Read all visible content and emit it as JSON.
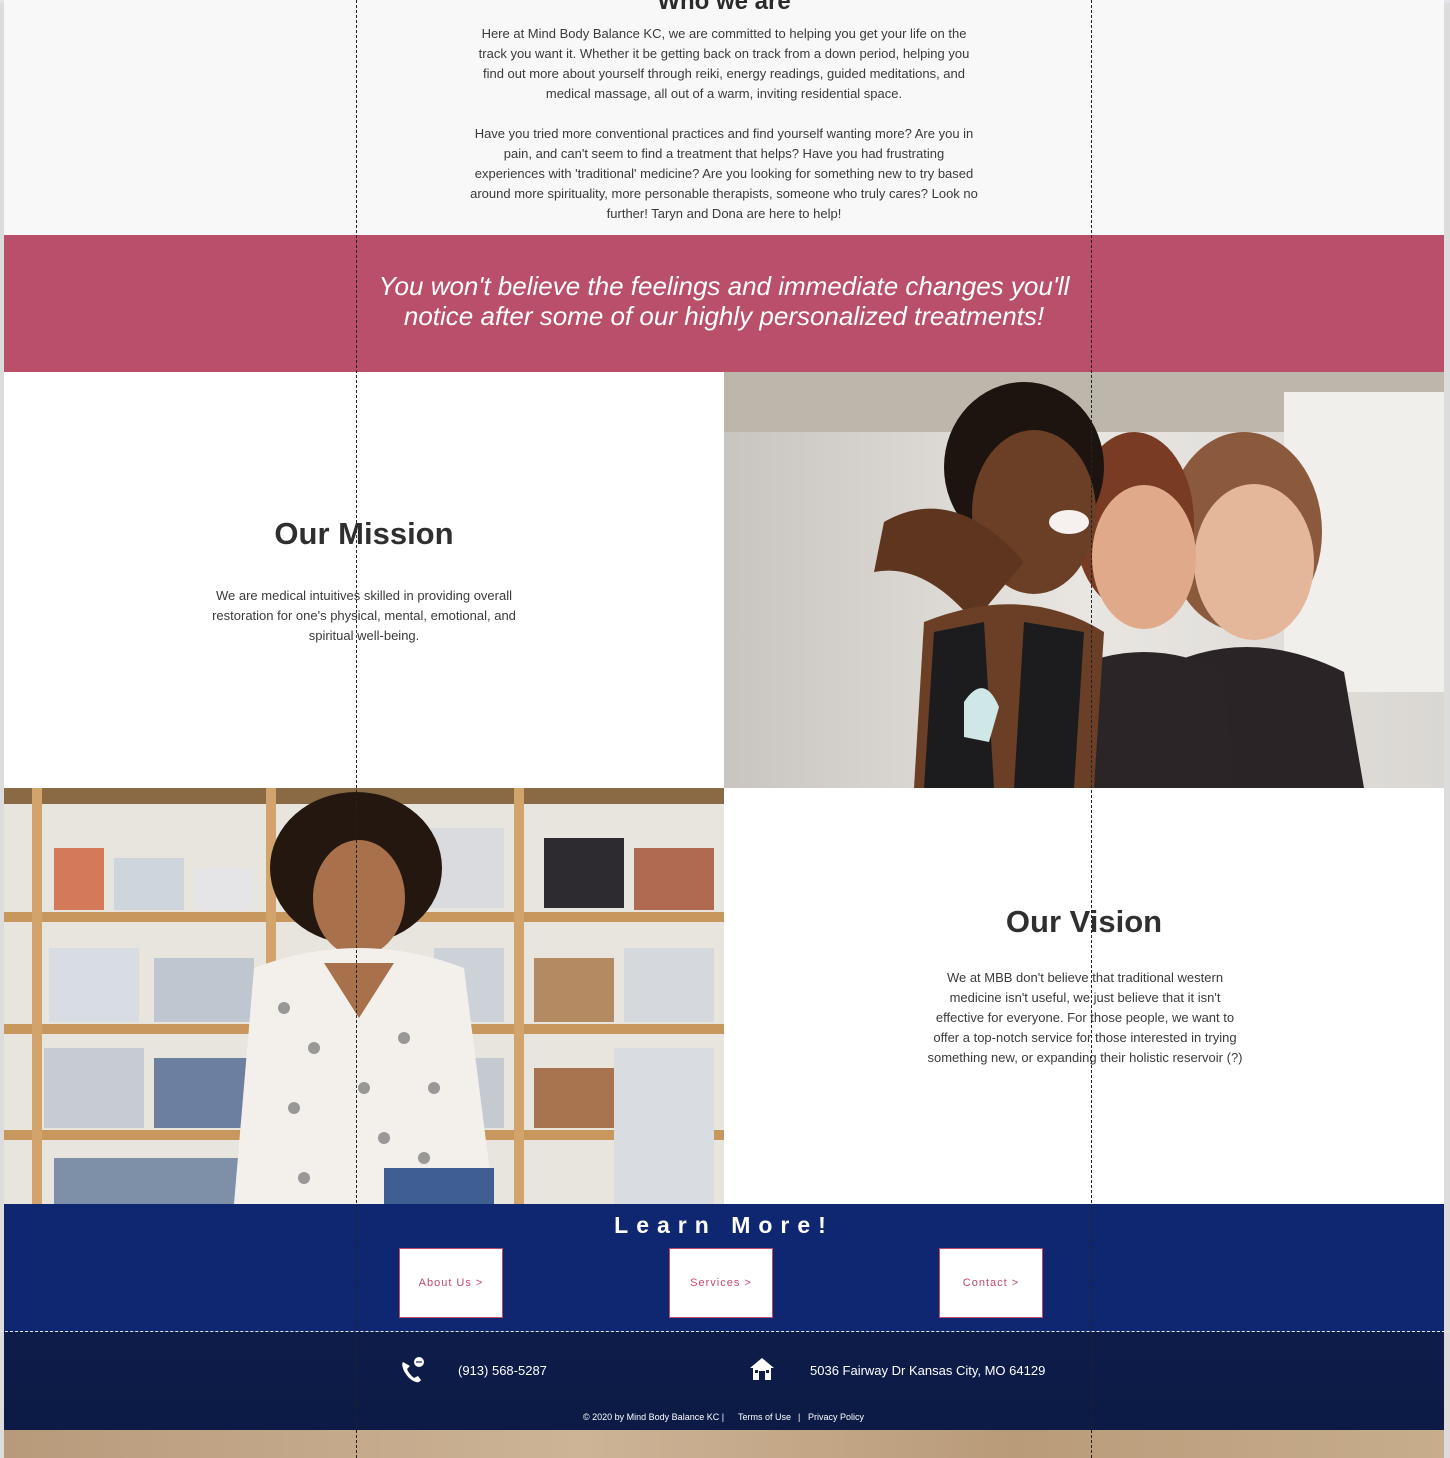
{
  "who_we_are": {
    "title": "Who we are",
    "paragraph1": "Here at Mind Body Balance KC, we are committed to helping you get your life on the track you want it. Whether it be getting back on track from a down period, helping you find out more about yourself through reiki, energy readings, guided meditations, and medical massage, all out of a warm, inviting residential space.",
    "paragraph2": "Have you tried more conventional practices and find yourself wanting more? Are you in pain, and can't seem to find a treatment that helps? Have you had frustrating experiences with 'traditional' medicine? Are you looking for something new to try based around more spirituality, more personable therapists, someone who truly cares? Look no further! Taryn and Dona are here to help!"
  },
  "banner": {
    "text": "You won't believe the feelings and immediate changes you'll notice after some of our highly personalized treatments!"
  },
  "mission": {
    "title": "Our Mission",
    "text": "We are medical intuitives skilled in providing overall restoration for one's physical, mental, emotional, and spiritual well-being."
  },
  "vision": {
    "title": "Our Vision",
    "text": "We at MBB don't believe that traditional western medicine isn't useful, we just believe that it isn't effective for everyone. For those people, we want to offer a top-notch service for those interested in trying something new, or expanding their holistic reservoir (?)"
  },
  "learn_more": {
    "title": "Learn More!",
    "buttons": [
      {
        "label": "About Us >"
      },
      {
        "label": "Services >"
      },
      {
        "label": "Contact >"
      }
    ]
  },
  "footer": {
    "phone": "(913) 568-5287",
    "address": "5036 Fairway Dr Kansas City, MO 64129",
    "copyright": "© 2020 by Mind Body Balance KC |",
    "terms": "Terms of Use",
    "separator": "|",
    "privacy": "Privacy Policy"
  },
  "colors": {
    "banner": "#b94f69",
    "learn_more_bg": "#0f2770",
    "footer_bg": "#0e1c4a",
    "button_text": "#c04a6a"
  },
  "icons": {
    "phone": "phone-icon",
    "home": "home-icon"
  }
}
